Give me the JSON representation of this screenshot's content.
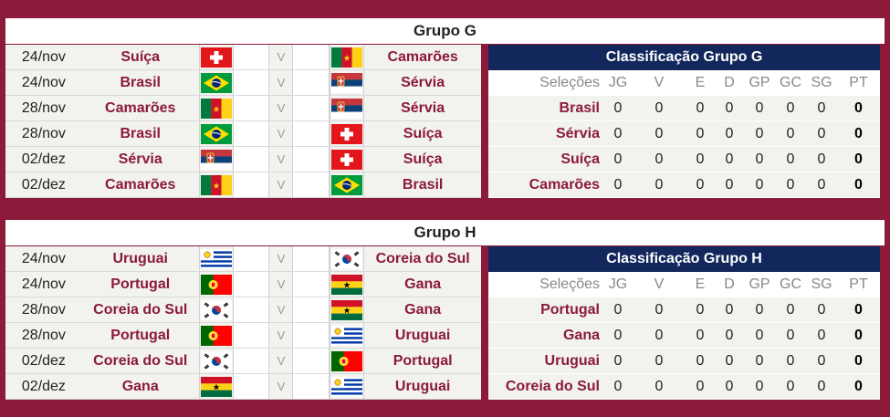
{
  "groups": [
    {
      "title": "Grupo G",
      "standings_title": "Classificação Grupo G",
      "matches": [
        {
          "date": "24/nov",
          "home": "Suíça",
          "home_flag": "switzerland-flag-icon",
          "vs": "V",
          "away": "Camarões",
          "away_flag": "cameroon-flag-icon"
        },
        {
          "date": "24/nov",
          "home": "Brasil",
          "home_flag": "brazil-flag-icon",
          "vs": "V",
          "away": "Sérvia",
          "away_flag": "serbia-flag-icon"
        },
        {
          "date": "28/nov",
          "home": "Camarões",
          "home_flag": "cameroon-flag-icon",
          "vs": "V",
          "away": "Sérvia",
          "away_flag": "serbia-flag-icon"
        },
        {
          "date": "28/nov",
          "home": "Brasil",
          "home_flag": "brazil-flag-icon",
          "vs": "V",
          "away": "Suíça",
          "away_flag": "switzerland-flag-icon"
        },
        {
          "date": "02/dez",
          "home": "Sérvia",
          "home_flag": "serbia-flag-icon",
          "vs": "V",
          "away": "Suíça",
          "away_flag": "switzerland-flag-icon"
        },
        {
          "date": "02/dez",
          "home": "Camarões",
          "home_flag": "cameroon-flag-icon",
          "vs": "V",
          "away": "Brasil",
          "away_flag": "brazil-flag-icon"
        }
      ],
      "standings": [
        {
          "team": "Brasil",
          "jg": "0",
          "v": "0",
          "e": "0",
          "d": "0",
          "gp": "0",
          "gc": "0",
          "sg": "0",
          "pt": "0"
        },
        {
          "team": "Sérvia",
          "jg": "0",
          "v": "0",
          "e": "0",
          "d": "0",
          "gp": "0",
          "gc": "0",
          "sg": "0",
          "pt": "0"
        },
        {
          "team": "Suíça",
          "jg": "0",
          "v": "0",
          "e": "0",
          "d": "0",
          "gp": "0",
          "gc": "0",
          "sg": "0",
          "pt": "0"
        },
        {
          "team": "Camarões",
          "jg": "0",
          "v": "0",
          "e": "0",
          "d": "0",
          "gp": "0",
          "gc": "0",
          "sg": "0",
          "pt": "0"
        }
      ]
    },
    {
      "title": "Grupo H",
      "standings_title": "Classificação Grupo H",
      "matches": [
        {
          "date": "24/nov",
          "home": "Uruguai",
          "home_flag": "uruguay-flag-icon",
          "vs": "V",
          "away": "Coreia do Sul",
          "away_flag": "south-korea-flag-icon"
        },
        {
          "date": "24/nov",
          "home": "Portugal",
          "home_flag": "portugal-flag-icon",
          "vs": "V",
          "away": "Gana",
          "away_flag": "ghana-flag-icon"
        },
        {
          "date": "28/nov",
          "home": "Coreia do Sul",
          "home_flag": "south-korea-flag-icon",
          "vs": "V",
          "away": "Gana",
          "away_flag": "ghana-flag-icon"
        },
        {
          "date": "28/nov",
          "home": "Portugal",
          "home_flag": "portugal-flag-icon",
          "vs": "V",
          "away": "Uruguai",
          "away_flag": "uruguay-flag-icon"
        },
        {
          "date": "02/dez",
          "home": "Coreia do Sul",
          "home_flag": "south-korea-flag-icon",
          "vs": "V",
          "away": "Portugal",
          "away_flag": "portugal-flag-icon"
        },
        {
          "date": "02/dez",
          "home": "Gana",
          "home_flag": "ghana-flag-icon",
          "vs": "V",
          "away": "Uruguai",
          "away_flag": "uruguay-flag-icon"
        }
      ],
      "standings": [
        {
          "team": "Portugal",
          "jg": "0",
          "v": "0",
          "e": "0",
          "d": "0",
          "gp": "0",
          "gc": "0",
          "sg": "0",
          "pt": "0"
        },
        {
          "team": "Gana",
          "jg": "0",
          "v": "0",
          "e": "0",
          "d": "0",
          "gp": "0",
          "gc": "0",
          "sg": "0",
          "pt": "0"
        },
        {
          "team": "Uruguai",
          "jg": "0",
          "v": "0",
          "e": "0",
          "d": "0",
          "gp": "0",
          "gc": "0",
          "sg": "0",
          "pt": "0"
        },
        {
          "team": "Coreia do Sul",
          "jg": "0",
          "v": "0",
          "e": "0",
          "d": "0",
          "gp": "0",
          "gc": "0",
          "sg": "0",
          "pt": "0"
        }
      ]
    }
  ],
  "standings_headers": {
    "team": "Seleções",
    "jg": "JG",
    "v": "V",
    "e": "E",
    "d": "D",
    "gp": "GP",
    "gc": "GC",
    "sg": "SG",
    "pt": "PT"
  },
  "colors": {
    "background": "#8c1a3a",
    "team_text": "#8c1a3a",
    "standings_header": "#12275c",
    "row_fill": "#f2f2ee"
  }
}
